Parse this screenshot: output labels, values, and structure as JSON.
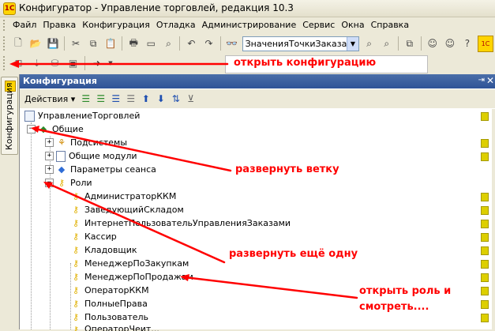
{
  "window": {
    "title": "Конфигуратор - Управление торговлей, редакция 10.3",
    "app_icon_label": "1С"
  },
  "menu": [
    "Файл",
    "Правка",
    "Конфигурация",
    "Отладка",
    "Администрирование",
    "Сервис",
    "Окна",
    "Справка"
  ],
  "toolbar": {
    "combo_value": "ЗначенияТочкиЗаказа"
  },
  "sidetab": {
    "label": "Конфигурация"
  },
  "panel": {
    "title": "Конфигурация",
    "actions_label": "Действия ▾"
  },
  "tree": {
    "root": "УправлениеТорговлей",
    "common": "Общие",
    "subsystems": "Подсистемы",
    "common_modules": "Общие модули",
    "session_params": "Параметры сеанса",
    "roles": "Роли",
    "role_items": [
      "АдминистраторККМ",
      "ЗаведующийСкладом",
      "ИнтернетПользовательУправленияЗаказами",
      "Кассир",
      "Кладовщик",
      "МенеджерПоЗакупкам",
      "МенеджерПоПродажам",
      "ОператорККМ",
      "ПолныеПрава",
      "Пользователь",
      "ОператорЧеит..."
    ]
  },
  "annotations": {
    "open_config": "открыть  конфигурацию",
    "expand_branch": "развернуть  ветку",
    "expand_another": "развернуть  ещё  одну",
    "open_role_1": "открыть  роль  и",
    "open_role_2": "смотреть...."
  },
  "colors": {
    "annotation": "#ff0000",
    "panel_header": "#3a5fa0"
  }
}
